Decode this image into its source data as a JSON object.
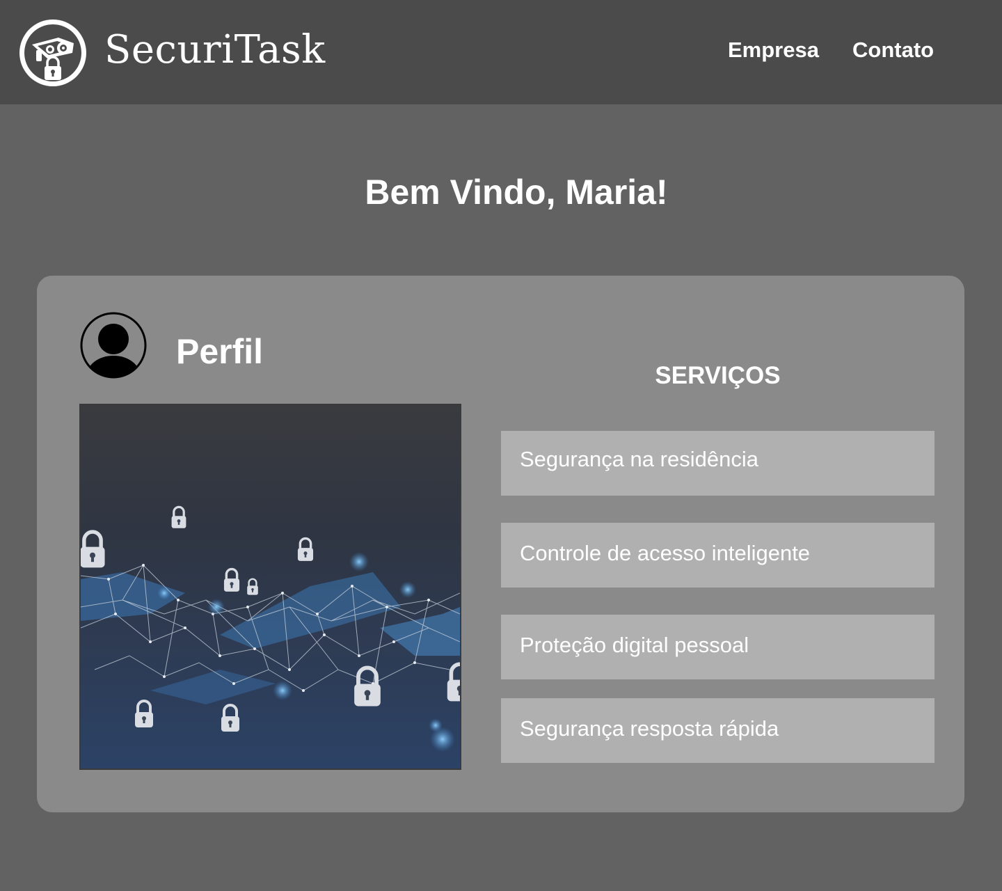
{
  "header": {
    "brand": "SecuriTask",
    "logo_icon": "security-camera-lock-icon",
    "nav": [
      {
        "label": "Empresa"
      },
      {
        "label": "Contato"
      }
    ]
  },
  "welcome": {
    "title": "Bem Vindo, Maria!"
  },
  "profile": {
    "title": "Perfil",
    "avatar_icon": "user-avatar-icon",
    "image_icon": "cyber-security-network-locks-image"
  },
  "services": {
    "title": "SERVIÇOS",
    "items": [
      {
        "label": "Segurança na residência"
      },
      {
        "label": "Controle de acesso inteligente"
      },
      {
        "label": "Proteção digital pessoal"
      },
      {
        "label": "Segurança resposta rápida"
      }
    ]
  },
  "colors": {
    "page_bg": "#626262",
    "header_bg": "#4b4b4b",
    "card_bg": "#8a8a8a",
    "service_bg": "#b0b0b0",
    "text": "#ffffff"
  }
}
